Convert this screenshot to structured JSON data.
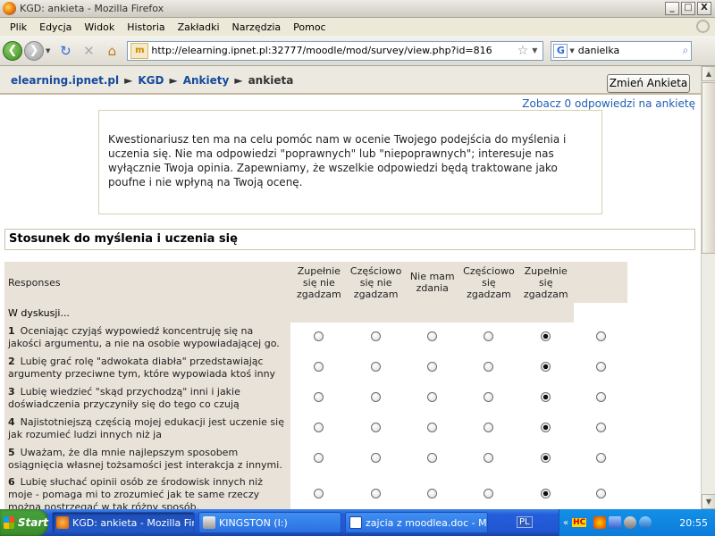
{
  "window": {
    "title": "KGD: ankieta - Mozilla Firefox",
    "controls": {
      "minimize": "_",
      "maximize": "□",
      "close": "X"
    }
  },
  "menu": [
    "Plik",
    "Edycja",
    "Widok",
    "Historia",
    "Zakładki",
    "Narzędzia",
    "Pomoc"
  ],
  "navbar": {
    "url": "http://elearning.ipnet.pl:32777/moodle/mod/survey/view.php?id=816",
    "site_icon_label": "m",
    "search_engine_label": "G",
    "search_value": "danielka"
  },
  "breadcrumb": {
    "items": [
      "elearning.ipnet.pl",
      "KGD",
      "Ankiety"
    ],
    "current": "ankieta",
    "separator": "►"
  },
  "buttons": {
    "change_survey": "Zmień Ankieta"
  },
  "links": {
    "view_responses": "Zobacz 0 odpowiedzi na ankietę"
  },
  "intro_text": "Kwestionariusz ten ma na celu pomóc nam w ocenie Twojego podejścia do myślenia i uczenia się. Nie ma odpowiedzi \"poprawnych\" lub \"niepoprawnych\"; interesuje nas wyłącznie Twoja opinia. Zapewniamy, że wszelkie odpowiedzi będą traktowane jako poufne i nie wpłyną na Twoją ocenę.",
  "section_title": "Stosunek do myślenia i uczenia się",
  "table": {
    "header_responses": "Responses",
    "columns": [
      "Zupełnie się nie zgadzam",
      "Częściowo się nie zgadzam",
      "Nie mam zdania",
      "Częściowo się zgadzam",
      "Zupełnie się zgadzam"
    ],
    "group_label": "W dyskusji...",
    "questions": [
      {
        "num": "1",
        "text": "Oceniając czyjąś wypowiedź koncentruję się na jakości argumentu, a nie na osobie wypowiadającej go.",
        "selected": 5
      },
      {
        "num": "2",
        "text": "Lubię grać rolę \"adwokata diabła\" przedstawiając argumenty przeciwne tym, które wypowiada ktoś inny",
        "selected": 5
      },
      {
        "num": "3",
        "text": "Lubię wiedzieć \"skąd przychodzą\" inni i jakie doświadczenia przyczyniły się do tego co czują",
        "selected": 5
      },
      {
        "num": "4",
        "text": "Najistotniejszą częścią mojej edukacji jest uczenie się jak rozumieć ludzi innych niż ja",
        "selected": 5
      },
      {
        "num": "5",
        "text": "Uważam, że dla mnie najlepszym sposobem osiągnięcia własnej tożsamości jest interakcja z innymi.",
        "selected": 5
      },
      {
        "num": "6",
        "text": "Lubię słuchać opinii osób ze środowisk innych niż moje - pomaga mi to zrozumieć jak te same rzeczy można postrzegać w tak różny sposób.",
        "selected": 5
      }
    ]
  },
  "taskbar": {
    "start_label": "Start",
    "tasks": [
      {
        "label": "KGD: ankieta - Mozilla Fir...",
        "icon": "firefox-icon",
        "active": true
      },
      {
        "label": "KINGSTON (I:)",
        "icon": "drive-icon",
        "active": false
      },
      {
        "label": "zajcia z moodlea.doc - Mi...",
        "icon": "word-doc-icon",
        "active": false
      }
    ],
    "language": "PL",
    "tray_text": "HC",
    "clock": "20:55"
  }
}
